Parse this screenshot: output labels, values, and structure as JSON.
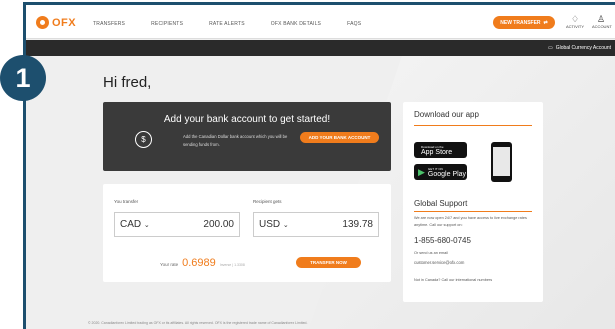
{
  "badge": "1",
  "nav": {
    "logo": "OFX",
    "links": [
      "TRANSFERS",
      "RECIPIENTS",
      "RATE ALERTS",
      "OFX BANK DETAILS",
      "FAQS"
    ],
    "new_transfer": "NEW TRANSFER",
    "activity": "ACTIVITY",
    "account": "ACCOUNT"
  },
  "subbar": {
    "label": "Global Currency Account"
  },
  "greeting": "Hi fred,",
  "bank_card": {
    "title": "Add your bank account to get started!",
    "desc": "Add the Canadian Dollar bank account which you will be sending funds from.",
    "button": "ADD YOUR BANK ACCOUNT"
  },
  "transfer": {
    "you_transfer_label": "You transfer",
    "from_currency": "CAD",
    "from_amount": "200.00",
    "recipient_label": "Recipient gets",
    "to_currency": "USD",
    "to_amount": "139.78",
    "rate_label": "Your rate",
    "rate_value": "0.6989",
    "rate_small": "Inverse | 1.3308",
    "button": "TRANSFER NOW"
  },
  "app": {
    "title": "Download our app",
    "appstore_small": "Download on the",
    "appstore": "App Store",
    "google_small": "GET IT ON",
    "google": "Google Play"
  },
  "support": {
    "title": "Global Support",
    "text": "We are now open 24/7 and you have access to live exchange rates anytime. Call our support on:",
    "phone": "1-855-680-0745",
    "email_label": "Or send us an email",
    "email": "customer.service@ofx.com",
    "not_canada": "Not in Canada? Call our international numbers"
  },
  "footer": "© 2020. Canadianforex Limited trading as OFX or its affiliates. All rights reserved. OFX is the registered trade name of Canadianforex Limited.",
  "colors": {
    "brand": "#f07c1c",
    "navy": "#1d4f6e",
    "dark": "#3a3a3a"
  }
}
